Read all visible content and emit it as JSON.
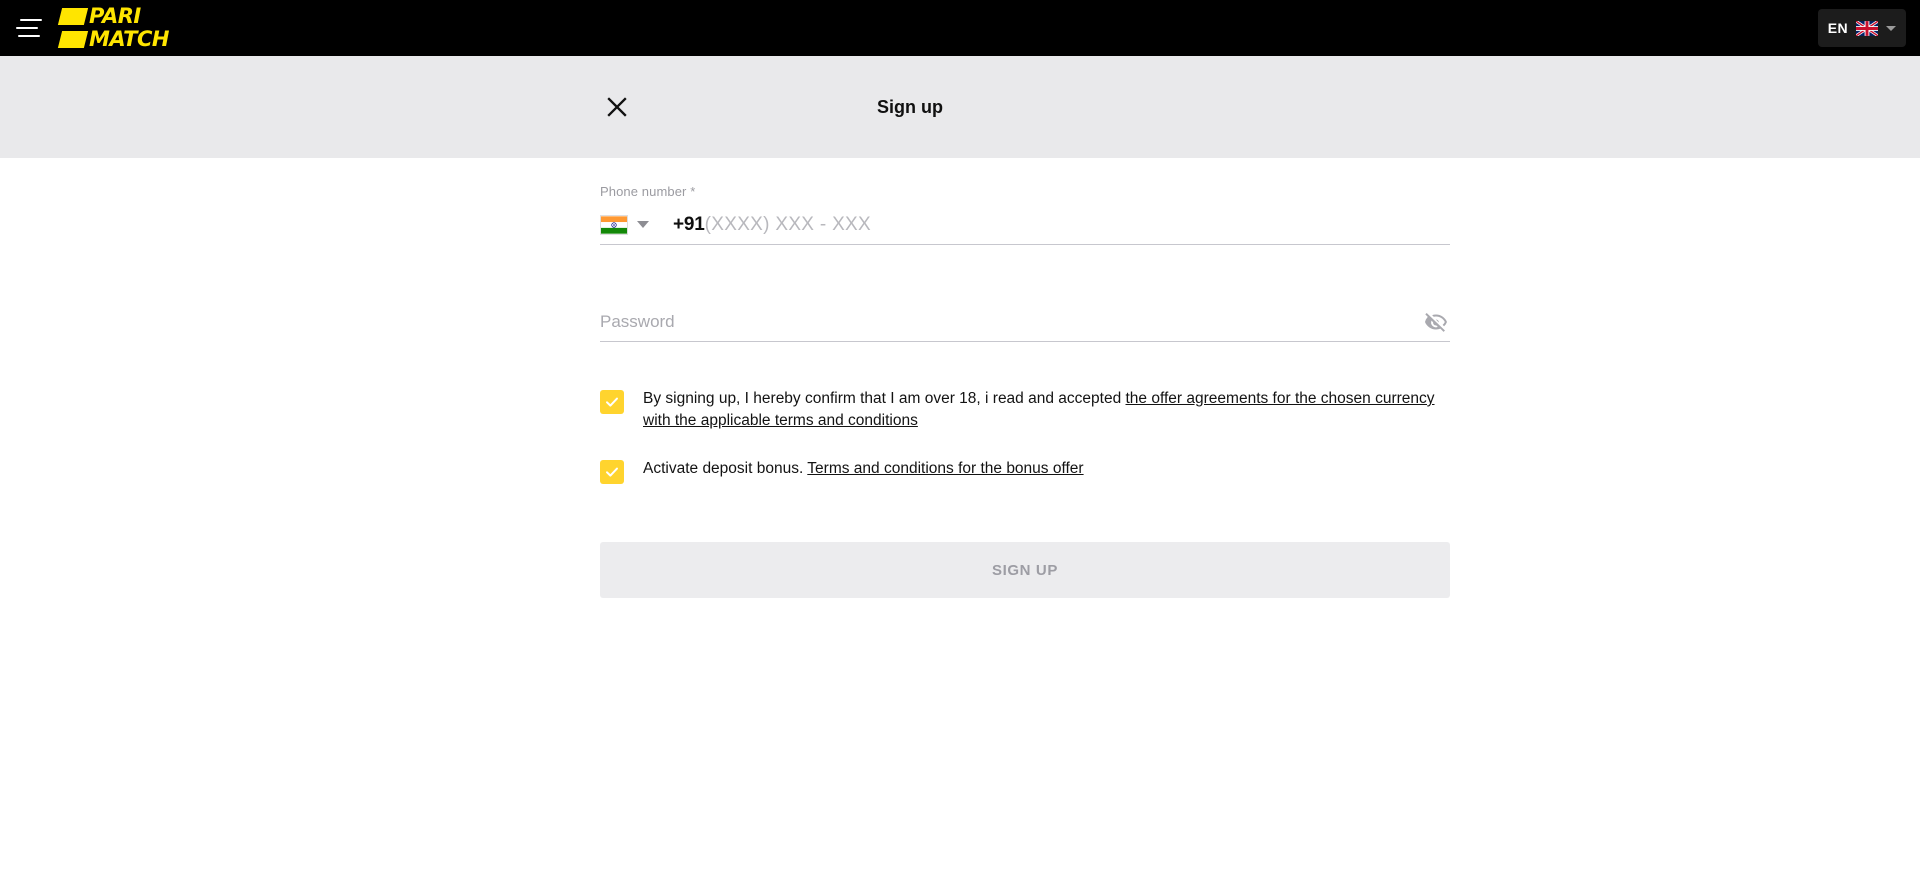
{
  "topbar": {
    "menu_icon": "hamburger-menu-icon",
    "logo_line1": "PARI",
    "logo_line2": "MATCH",
    "language": {
      "code": "EN",
      "flag": "uk-flag-icon",
      "chevron": "chevron-down-icon"
    },
    "background": "#000000",
    "logo_color": "#ffe500"
  },
  "modal": {
    "close_icon": "close-x-icon",
    "title": "Sign up",
    "header_background": "#e9e9eb"
  },
  "form": {
    "phone": {
      "label": "Phone number",
      "required_mark": "*",
      "country_flag": "india-flag-icon",
      "country_caret": "chevron-down-icon",
      "dial_code": "+91",
      "placeholder": "(XXXX) XXX - XXX",
      "value": ""
    },
    "password": {
      "placeholder": "Password",
      "value": "",
      "toggle_icon": "eye-off-icon"
    },
    "terms_checkbox": {
      "checked": true,
      "text_before": "By signing up, I hereby confirm that I am over 18, i read and accepted ",
      "link_text": "the offer agreements for the chosen currency with the applicable terms and conditions"
    },
    "bonus_checkbox": {
      "checked": true,
      "text_before": "Activate deposit bonus. ",
      "link_text": "Terms and conditions for the bonus offer"
    },
    "submit": {
      "label": "SIGN UP",
      "disabled": true,
      "background": "#ececee",
      "text_color": "#9d9da4"
    },
    "accent_color": "#ffd42e"
  }
}
